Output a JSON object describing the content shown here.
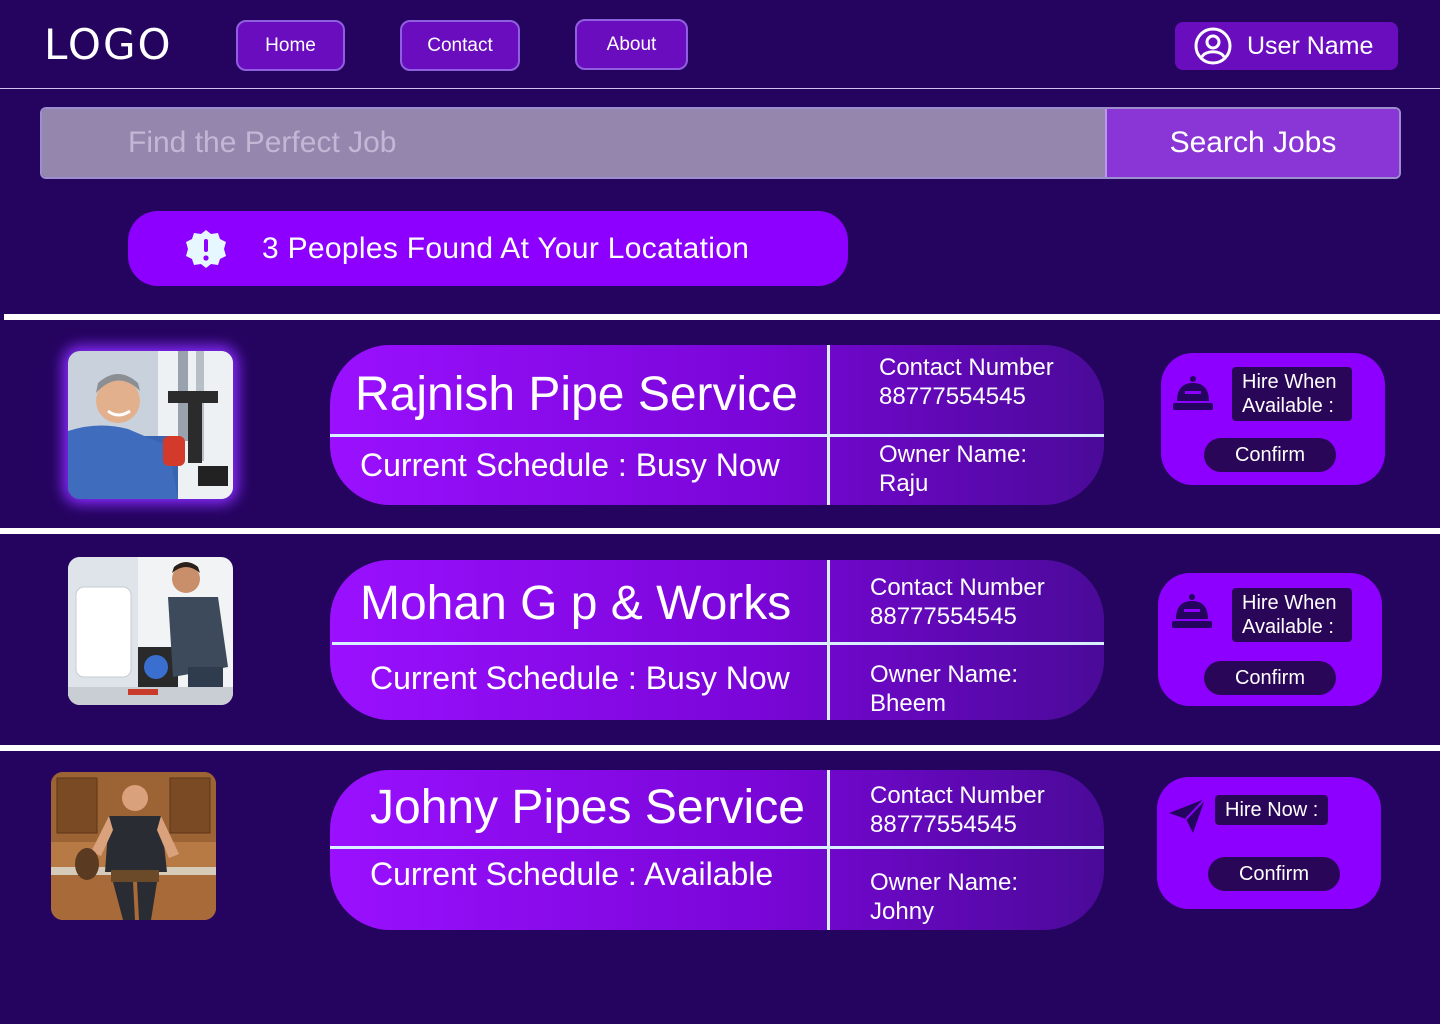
{
  "header": {
    "logo": "LOGO",
    "nav": [
      {
        "label": "Home"
      },
      {
        "label": "Contact"
      },
      {
        "label": "About"
      }
    ],
    "user": {
      "label": "User Name",
      "icon": "user-circle-icon"
    }
  },
  "search": {
    "placeholder": "Find the Perfect Job",
    "button_label": "Search Jobs"
  },
  "banner": {
    "icon": "alert-badge-icon",
    "text": "3 Peoples Found At Your Locatation"
  },
  "listings": [
    {
      "name": "Rajnish Pipe Service",
      "schedule": "Current Schedule : Busy Now",
      "contact_label": "Contact Number",
      "contact_number": "88777554545",
      "owner_label": "Owner Name:",
      "owner_name": "Raju",
      "hire_label": "Hire When Available :",
      "hire_icon": "service-bell-icon",
      "confirm_label": "Confirm"
    },
    {
      "name": "Mohan G p & Works",
      "schedule": "Current Schedule : Busy Now",
      "contact_label": "Contact Number",
      "contact_number": "88777554545",
      "owner_label": "Owner Name:",
      "owner_name": "Bheem",
      "hire_label": "Hire When Available :",
      "hire_icon": "service-bell-icon",
      "confirm_label": "Confirm"
    },
    {
      "name": "Johny Pipes Service",
      "schedule": "Current Schedule : Available",
      "contact_label": "Contact Number",
      "contact_number": "88777554545",
      "owner_label": "Owner Name:",
      "owner_name": "Johny",
      "hire_label": "Hire Now :",
      "hire_icon": "send-icon",
      "confirm_label": "Confirm"
    }
  ],
  "colors": {
    "background": "#25045f",
    "accent": "#8d00ff",
    "nav_button": "#6a0dbf",
    "dark_chip": "#2a0658"
  }
}
